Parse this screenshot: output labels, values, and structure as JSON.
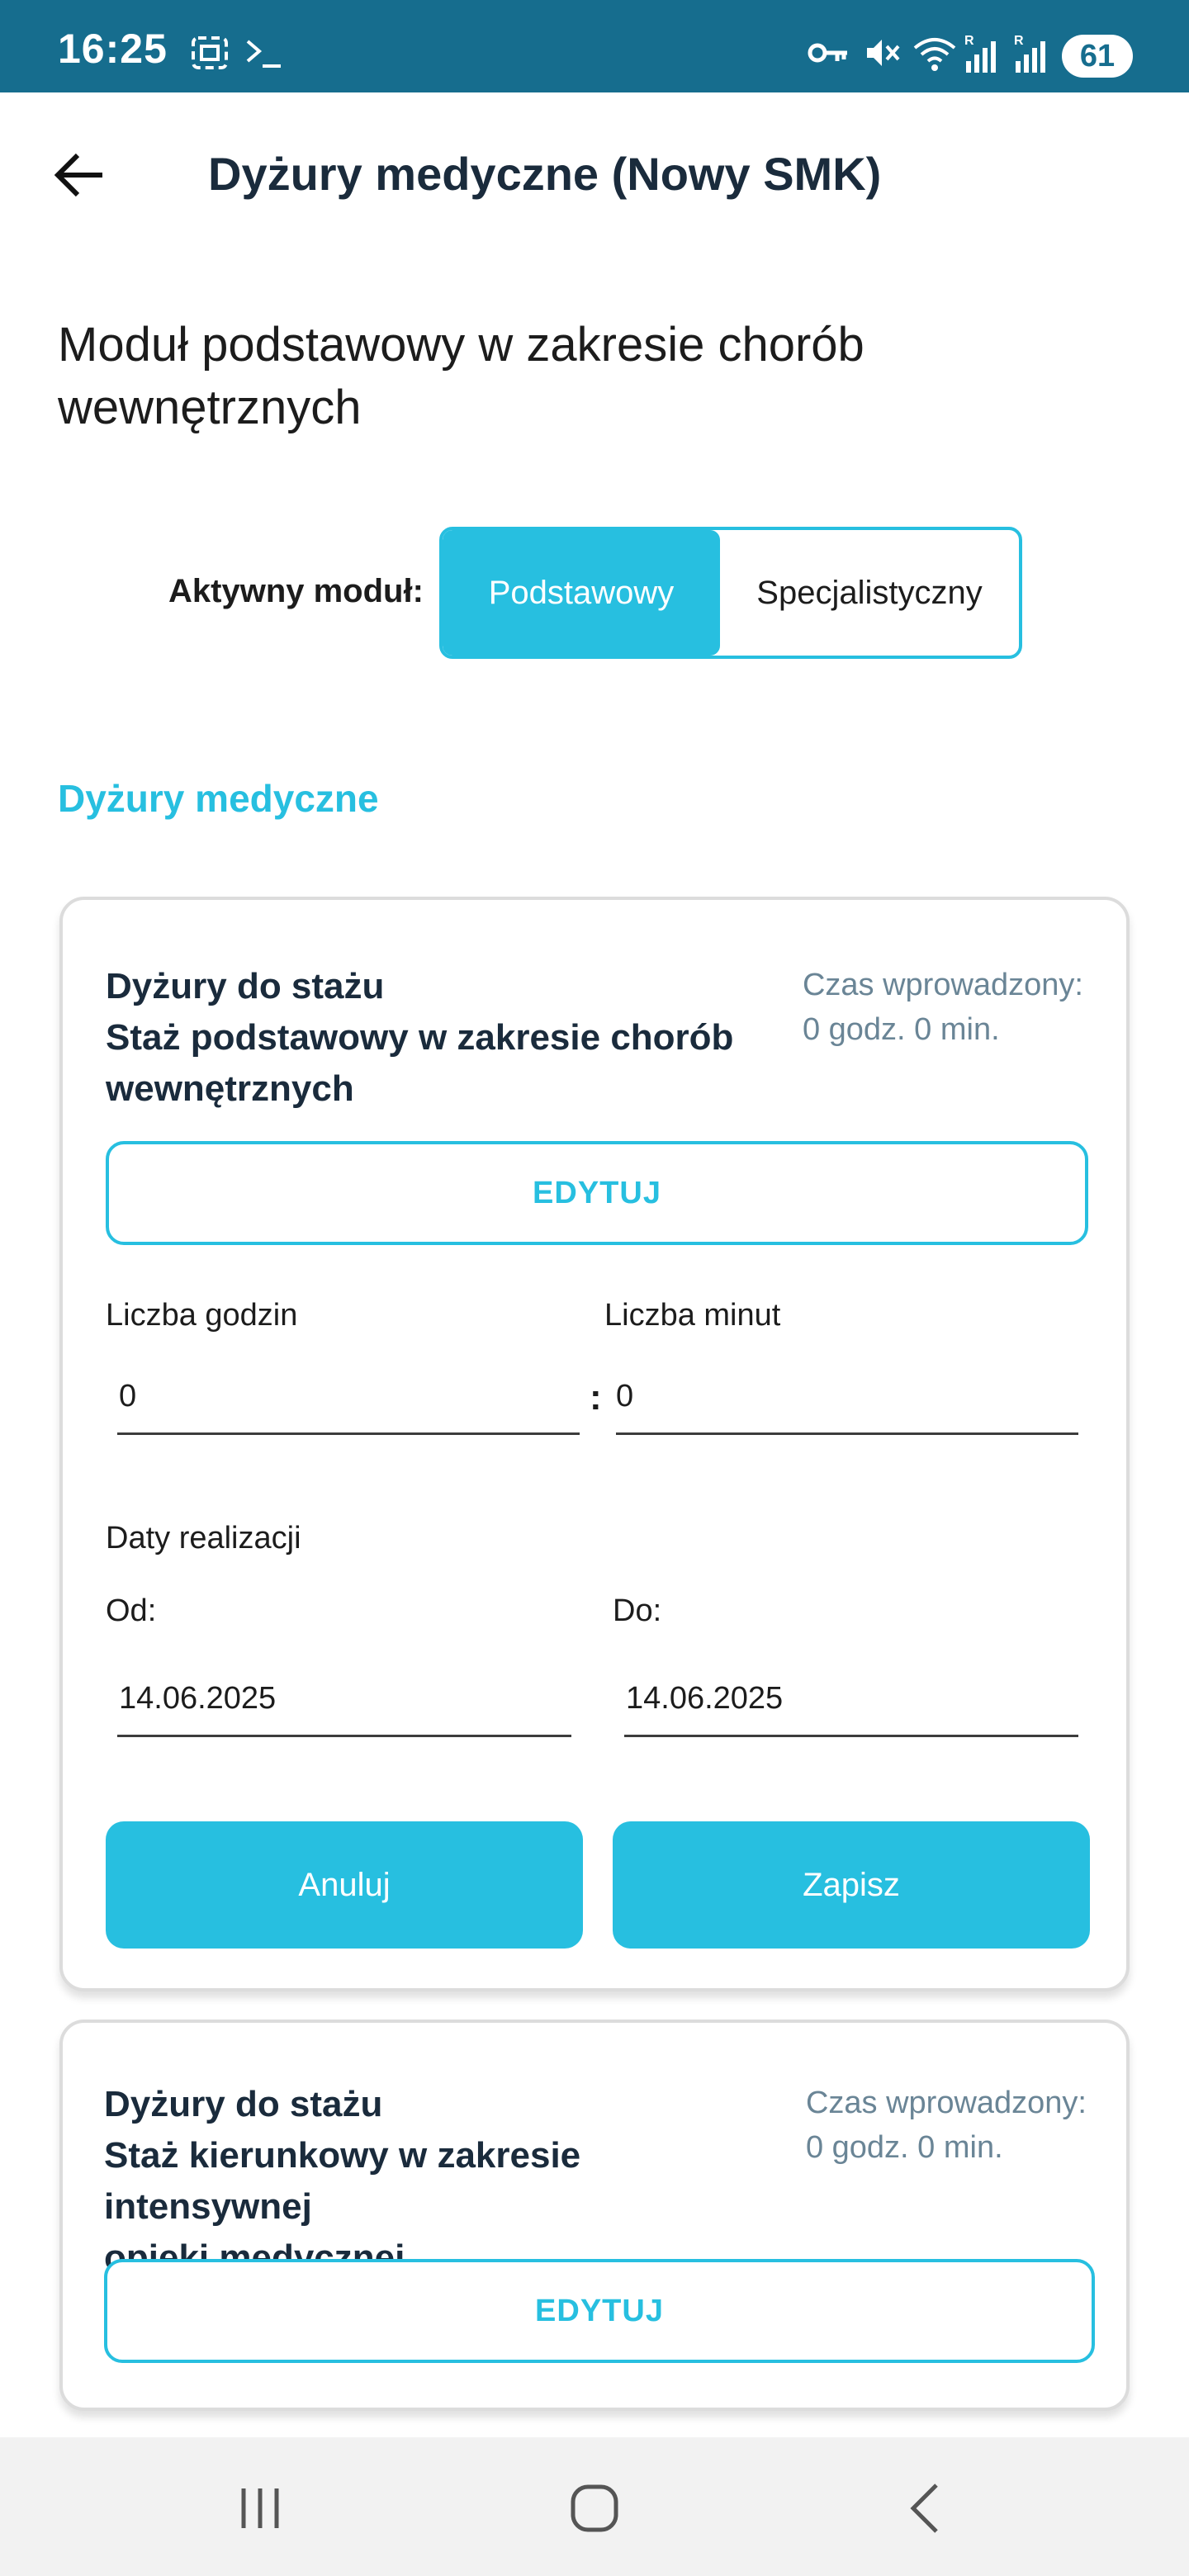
{
  "status_bar": {
    "time": "16:25",
    "battery": "61",
    "background_color": "#166d8e"
  },
  "app_bar": {
    "back_icon": "arrow-left-icon",
    "title": "Dyżury medyczne (Nowy SMK)"
  },
  "module": {
    "title_line1": "Moduł podstawowy w zakresie chorób",
    "title_line2": "wewnętrznych",
    "active_label": "Aktywny moduł:",
    "options": [
      "Podstawowy",
      "Specjalistyczny"
    ],
    "selected": "Podstawowy"
  },
  "section_title": "Dyżury medyczne",
  "cards": [
    {
      "heading1": "Dyżury do stażu",
      "heading2": "Staż podstawowy w zakresie chorób",
      "heading3": "wewnętrznych",
      "time_label": "Czas wprowadzony:",
      "time_value": "0 godz. 0 min.",
      "edit_label": "EDYTUJ",
      "hours_label": "Liczba godzin",
      "minutes_label": "Liczba minut",
      "hours_value": "0",
      "minutes_value": "0",
      "dates_label": "Daty realizacji",
      "from_label": "Od:",
      "to_label": "Do:",
      "from_value": "14.06.2025",
      "to_value": "14.06.2025",
      "cancel_label": "Anuluj",
      "save_label": "Zapisz"
    },
    {
      "heading1": "Dyżury do stażu",
      "heading2": "Staż kierunkowy w zakresie intensywnej",
      "heading3": "opieki medycznej",
      "time_label": "Czas wprowadzony:",
      "time_value": "0 godz. 0 min.",
      "edit_label": "EDYTUJ"
    }
  ],
  "colors": {
    "accent": "#27bfe0",
    "heading": "#1a2b3c",
    "muted": "#6a8596"
  }
}
